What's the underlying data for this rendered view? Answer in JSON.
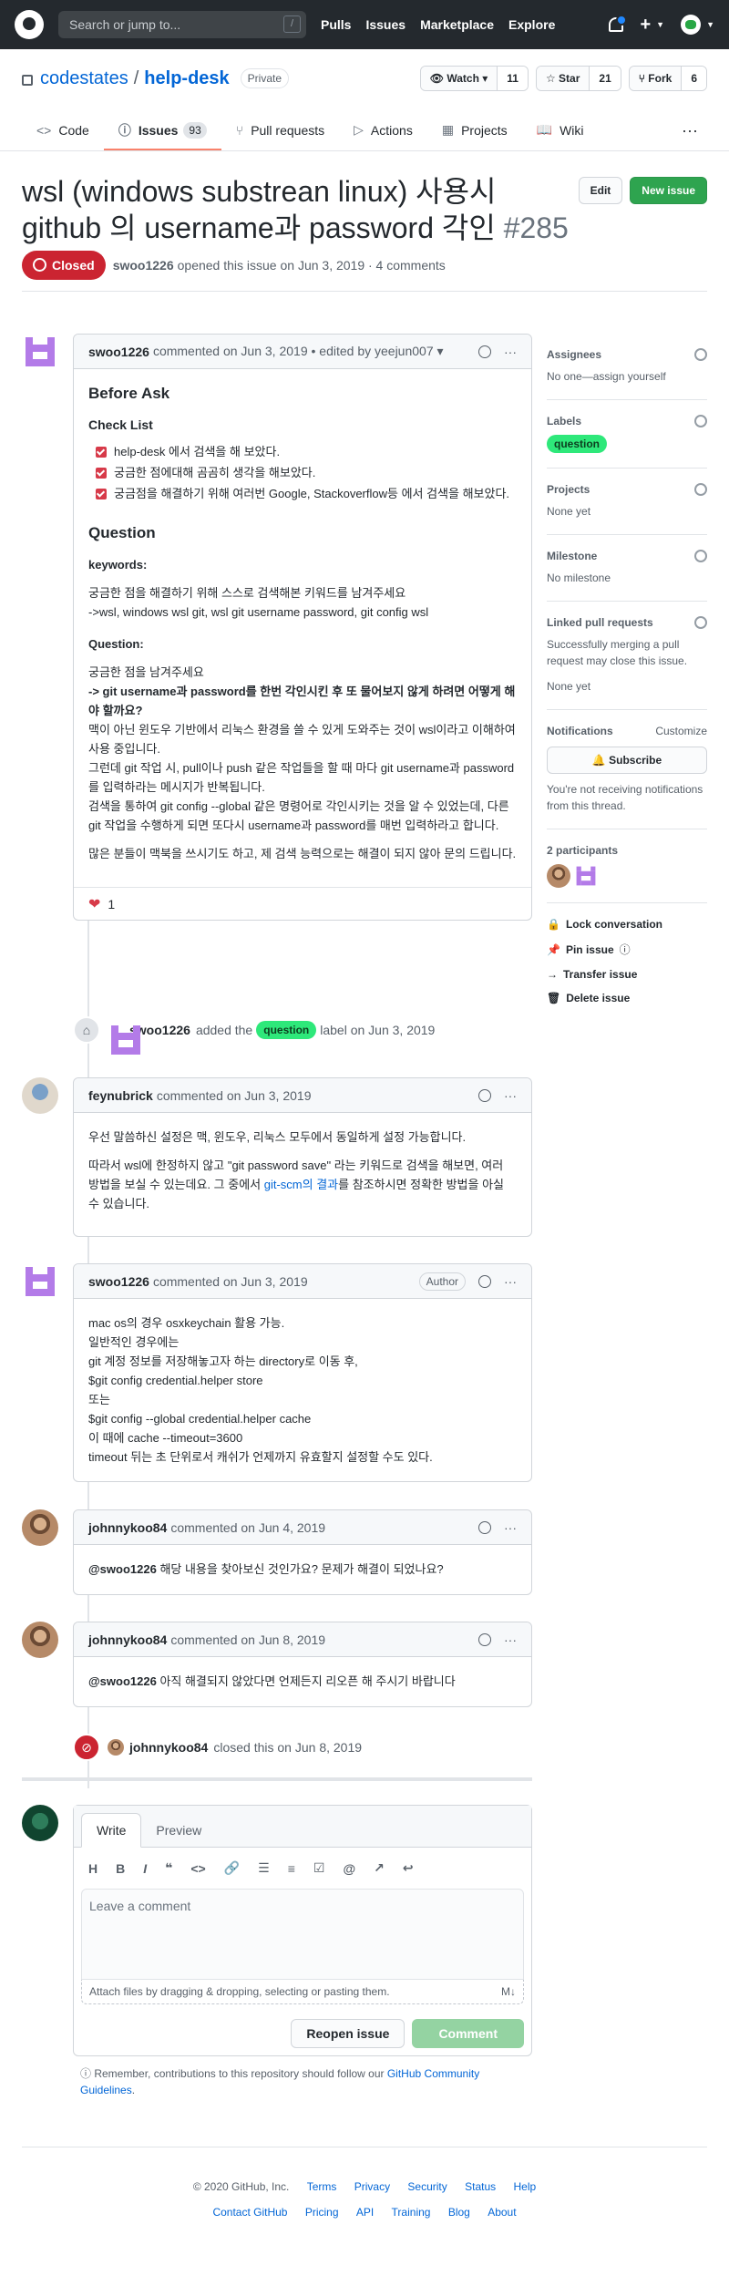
{
  "header": {
    "search_placeholder": "Search or jump to...",
    "search_key": "/",
    "nav": [
      "Pulls",
      "Issues",
      "Marketplace",
      "Explore"
    ]
  },
  "repo": {
    "owner": "codestates",
    "separator": "/",
    "name": "help-desk",
    "visibility": "Private",
    "watch": {
      "label": "Watch",
      "count": "11"
    },
    "star": {
      "label": "Star",
      "count": "21"
    },
    "fork": {
      "label": "Fork",
      "count": "6"
    },
    "tabs": [
      {
        "label": "Code",
        "icon": "<>"
      },
      {
        "label": "Issues",
        "icon": "ⓘ",
        "count": "93"
      },
      {
        "label": "Pull requests",
        "icon": "⑂"
      },
      {
        "label": "Actions",
        "icon": "▷"
      },
      {
        "label": "Projects",
        "icon": "▦"
      },
      {
        "label": "Wiki",
        "icon": "📖"
      }
    ]
  },
  "issue": {
    "title": "wsl (windows substrean linux) 사용시 github 의 username과 password 각인",
    "number": "#285",
    "edit": "Edit",
    "new_issue": "New issue",
    "state": "Closed",
    "author": "swoo1226",
    "opened_text": "opened this issue on Jun 3, 2019 · 4 comments"
  },
  "comment1": {
    "author": "swoo1226",
    "meta": "commented on Jun 3, 2019 • edited by yeejun007 ▾",
    "h_before": "Before Ask",
    "h_check": "Check List",
    "checks": [
      "help-desk 에서 검색을 해 보았다.",
      "궁금한 점에대해 곰곰히 생각을 해보았다.",
      "궁금점을 해결하기 위해 여러번 Google, Stackoverflow등 에서 검색을 해보았다."
    ],
    "h_question": "Question",
    "h_keywords": "keywords:",
    "keywords_text1": "궁금한 점을 해결하기 위해 스스로 검색해본 키워드를 남겨주세요",
    "keywords_text2": "->wsl, windows wsl git, wsl git username password, git config wsl",
    "h_question2": "Question:",
    "q_intro": "궁금한 점을 남겨주세요",
    "q_bold": "-> git username과 password를 한번 각인시킨 후 또 물어보지 않게 하려면 어떻게 해야 할까요?",
    "q_p1": "맥이 아닌 윈도우 기반에서 리눅스 환경을 쓸 수 있게 도와주는 것이 wsl이라고 이해하여 사용 중입니다.",
    "q_p2": "그런데 git 작업 시, pull이나 push 같은 작업들을 할 때 마다 git username과 password를 입력하라는 메시지가 반복됩니다.",
    "q_p3": "검색을 통하여 git config --global 같은 명령어로 각인시키는 것을 알 수 있었는데, 다른 git 작업을 수행하게 되면 또다시 username과 password를 매번 입력하라고 합니다.",
    "q_p4": "많은 분들이 맥북을 쓰시기도 하고, 제 검색 능력으로는 해결이 되지 않아 문의 드립니다.",
    "reaction_count": "1"
  },
  "label_event": {
    "author": "swoo1226",
    "pre": "added the",
    "label": "question",
    "post": "label on Jun 3, 2019"
  },
  "comment2": {
    "author": "feynubrick",
    "meta": "commented on Jun 3, 2019",
    "p1": "우선 말씀하신 설정은 맥, 윈도우, 리눅스 모두에서 동일하게 설정 가능합니다.",
    "p2a": "따라서 wsl에 한정하지 않고 \"git password save\" 라는 키워드로 검색을 해보면, 여러 방법을 보실 수 있는데요. 그 중에서 ",
    "p2link": "git-scm의 결과",
    "p2b": "를 참조하시면 정확한 방법을 아실 수 있습니다."
  },
  "comment3": {
    "author": "swoo1226",
    "meta": "commented on Jun 3, 2019",
    "badge": "Author",
    "lines": [
      "mac os의 경우 osxkeychain 활용 가능.",
      "일반적인 경우에는",
      "git 계정 정보를 저장해놓고자 하는 directory로 이동 후,",
      "$git config credential.helper store",
      "또는",
      "$git config --global credential.helper cache",
      "이 때에 cache --timeout=3600",
      "timeout 뒤는 초 단위로서 캐쉬가 언제까지 유효할지 설정할 수도 있다."
    ]
  },
  "comment4": {
    "author": "johnnykoo84",
    "meta": "commented on Jun 4, 2019",
    "mention": "@swoo1226",
    "text": " 해당 내용을 찾아보신 것인가요? 문제가 해결이 되었나요?"
  },
  "comment5": {
    "author": "johnnykoo84",
    "meta": "commented on Jun 8, 2019",
    "mention": "@swoo1226",
    "text": " 아직 해결되지 않았다면 언제든지 리오픈 해 주시기 바랍니다"
  },
  "close_event": {
    "author": "johnnykoo84",
    "text": "closed this on Jun 8, 2019"
  },
  "form": {
    "write": "Write",
    "preview": "Preview",
    "placeholder": "Leave a comment",
    "attach": "Attach files by dragging & dropping, selecting or pasting them.",
    "reopen": "Reopen issue",
    "comment": "Comment",
    "note_pre": "Remember, contributions to this repository should follow our ",
    "note_link": "GitHub Community Guidelines",
    "note_post": "."
  },
  "sidebar": {
    "assignees": "Assignees",
    "assignees_val": "No one—assign yourself",
    "labels": "Labels",
    "label_val": "question",
    "projects": "Projects",
    "projects_val": "None yet",
    "milestone": "Milestone",
    "milestone_val": "No milestone",
    "linked": "Linked pull requests",
    "linked_desc": "Successfully merging a pull request may close this issue.",
    "linked_val": "None yet",
    "notifications": "Notifications",
    "customize": "Customize",
    "subscribe": "Subscribe",
    "notif_desc": "You're not receiving notifications from this thread.",
    "participants": "2 participants",
    "lock": "Lock conversation",
    "pin": "Pin issue",
    "transfer": "Transfer issue",
    "delete": "Delete issue"
  },
  "footer": {
    "copyright": "© 2020 GitHub, Inc.",
    "row1": [
      "Terms",
      "Privacy",
      "Security",
      "Status",
      "Help"
    ],
    "row2": [
      "Contact GitHub",
      "Pricing",
      "API",
      "Training",
      "Blog",
      "About"
    ]
  }
}
